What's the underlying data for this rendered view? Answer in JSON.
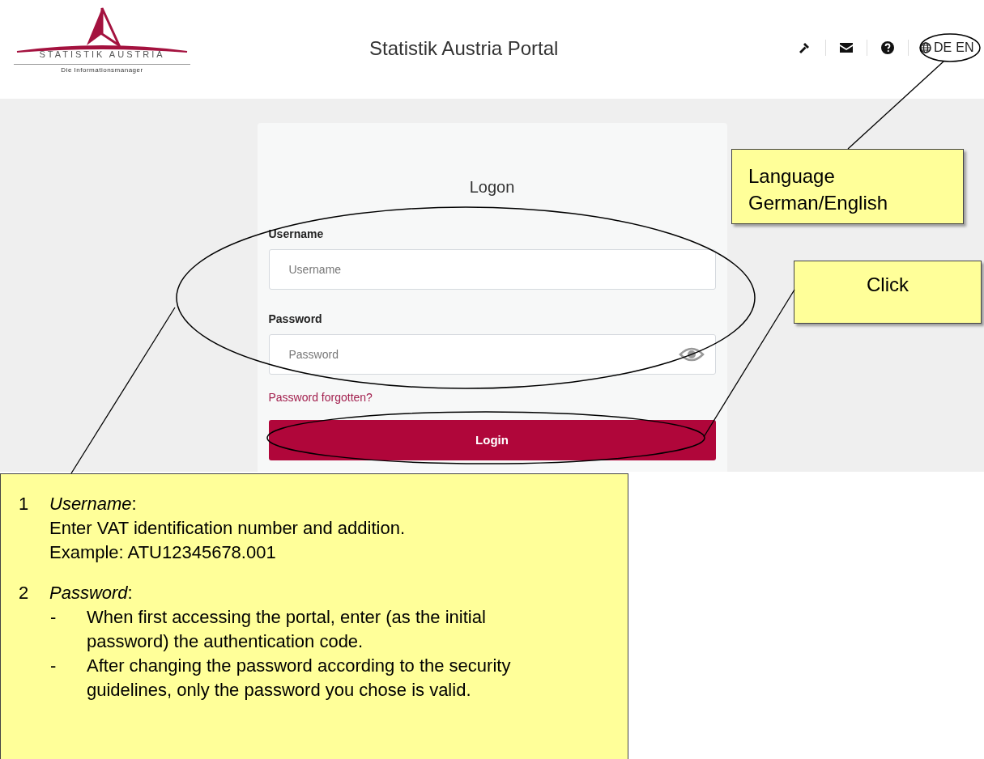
{
  "logo": {
    "name": "STATISTIK AUSTRIA",
    "tagline": "Die Informationsmanager"
  },
  "header": {
    "title": "Statistik Austria Portal",
    "languages": [
      {
        "label": "DE"
      },
      {
        "label": "EN"
      }
    ]
  },
  "form": {
    "title": "Logon",
    "fields": [
      {
        "label": "Username",
        "placeholder": "Username",
        "kind": "text"
      },
      {
        "label": "Password",
        "placeholder": "Password",
        "kind": "password"
      }
    ],
    "link": "Password forgotten?",
    "button": "Login"
  },
  "callouts": {
    "language": [
      "Language",
      "German/English"
    ],
    "click": "Click",
    "steps": [
      {
        "number": "1",
        "title": "*Username*:",
        "lines": [
          "Enter VAT identification number and addition.",
          "Example: ATU12345678.001"
        ]
      },
      {
        "number": "2",
        "title": "*Password*:",
        "bullets": [
          {
            "mark": "-",
            "text": "When first accessing the portal, enter (as the initial password) the authentication code."
          },
          {
            "mark": "-",
            "text": "After changing the password according to the security guidelines, only the password you chose is valid."
          }
        ]
      }
    ]
  }
}
